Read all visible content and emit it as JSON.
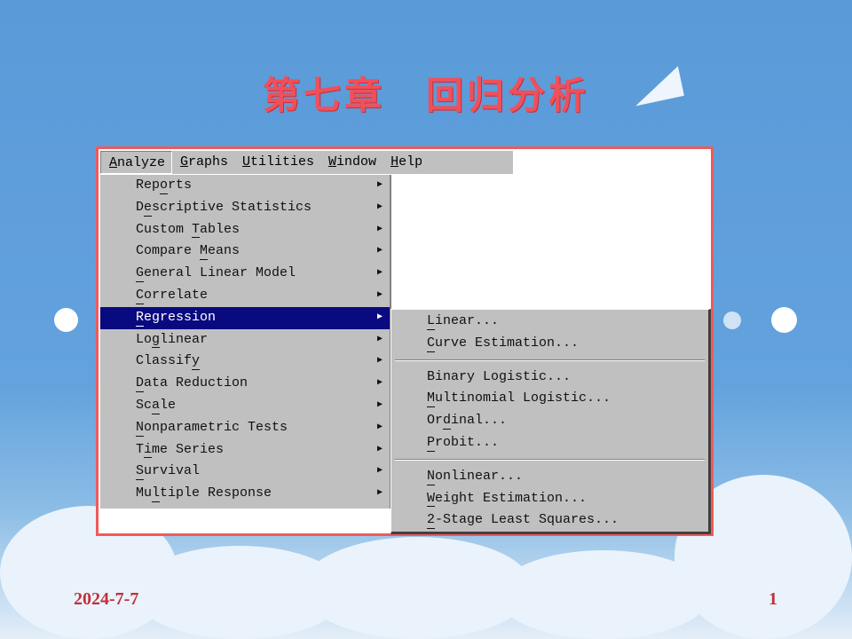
{
  "slide": {
    "title": "第七章　回归分析",
    "date": "2024-7-7",
    "page_number": "1"
  },
  "colors": {
    "background": "#5a9ad8",
    "frame_border": "#f05a5a",
    "title": "#f0505a",
    "menu_bg": "#c0c0c0",
    "highlight": "#0a0a80"
  },
  "menubar": [
    {
      "label": "Analyze",
      "m": 0,
      "active": true
    },
    {
      "label": "Graphs",
      "m": 0
    },
    {
      "label": "Utilities",
      "m": 0
    },
    {
      "label": "Window",
      "m": 0
    },
    {
      "label": "Help",
      "m": 0
    }
  ],
  "analyze_menu": [
    {
      "label": "Reports",
      "m": 3
    },
    {
      "label": "Descriptive Statistics",
      "m": 1
    },
    {
      "label": "Custom Tables",
      "m": 7
    },
    {
      "label": "Compare Means",
      "m": 8
    },
    {
      "label": "General Linear Model",
      "m": 0
    },
    {
      "label": "Correlate",
      "m": 0
    },
    {
      "label": "Regression",
      "m": 0,
      "selected": true
    },
    {
      "label": "Loglinear",
      "m": 2
    },
    {
      "label": "Classify",
      "m": 7
    },
    {
      "label": "Data Reduction",
      "m": 0
    },
    {
      "label": "Scale",
      "m": 2
    },
    {
      "label": "Nonparametric Tests",
      "m": 0
    },
    {
      "label": "Time Series",
      "m": 1
    },
    {
      "label": "Survival",
      "m": 0
    },
    {
      "label": "Multiple Response",
      "m": 2
    }
  ],
  "regression_submenu": [
    [
      {
        "label": "Linear...",
        "m": 0
      },
      {
        "label": "Curve Estimation...",
        "m": 0
      }
    ],
    [
      {
        "label": "Binary Logistic...",
        "m": -1
      },
      {
        "label": "Multinomial Logistic...",
        "m": 0
      },
      {
        "label": "Ordinal...",
        "m": 2
      },
      {
        "label": "Probit...",
        "m": 0
      }
    ],
    [
      {
        "label": "Nonlinear...",
        "m": 0
      },
      {
        "label": "Weight Estimation...",
        "m": 0
      },
      {
        "label": "2-Stage Least Squares...",
        "m": 0
      }
    ]
  ]
}
